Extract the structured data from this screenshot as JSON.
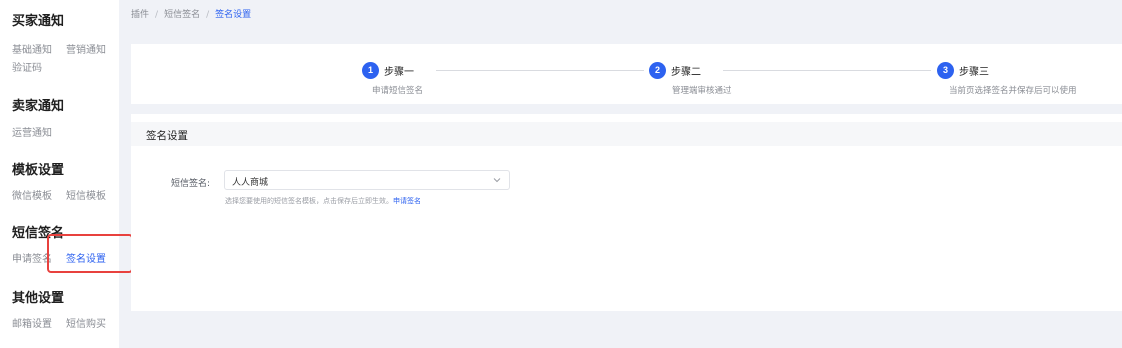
{
  "sidebar": {
    "groups": [
      {
        "title": "买家通知",
        "items": [
          "基础通知",
          "营销通知",
          "验证码"
        ]
      },
      {
        "title": "卖家通知",
        "items": [
          "运营通知"
        ]
      },
      {
        "title": "模板设置",
        "items": [
          "微信模板",
          "短信模板"
        ]
      },
      {
        "title": "短信签名",
        "items": [
          "申请签名",
          "签名设置"
        ]
      },
      {
        "title": "其他设置",
        "items": [
          "邮箱设置",
          "短信购买"
        ]
      }
    ],
    "active_item": "签名设置"
  },
  "breadcrumb": {
    "items": [
      "插件",
      "短信签名",
      "签名设置"
    ],
    "separator": "/"
  },
  "steps": [
    {
      "number": "1",
      "title": "步骤一",
      "desc": "申请短信签名"
    },
    {
      "number": "2",
      "title": "步骤二",
      "desc": "管理端审核通过"
    },
    {
      "number": "3",
      "title": "步骤三",
      "desc": "当前页选择签名并保存后可以使用"
    }
  ],
  "form": {
    "section_title": "签名设置",
    "field_label": "短信签名:",
    "select_value": "人人商城",
    "help_text": "选择您要使用的短信签名模板，点击保存后立即生效。",
    "help_link": "申请签名"
  },
  "colors": {
    "accent": "#2d62f0",
    "highlight": "#e8413e",
    "background": "#f0f2f7"
  }
}
